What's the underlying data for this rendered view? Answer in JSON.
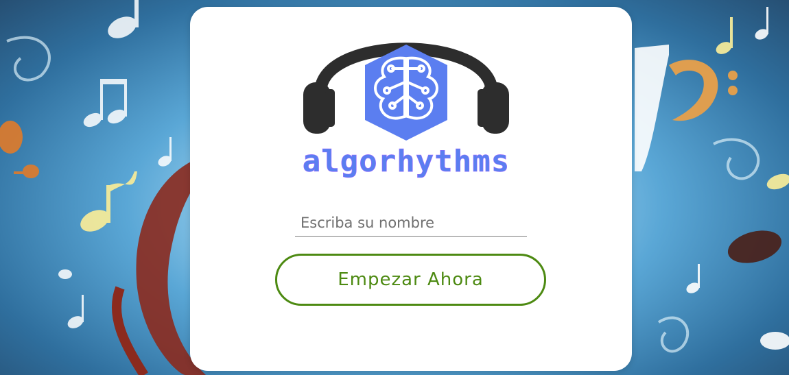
{
  "brand": {
    "wordmark": "algorhythms"
  },
  "form": {
    "name_placeholder": "Escriba su nombre",
    "name_value": "",
    "start_label": "Empezar Ahora"
  },
  "colors": {
    "accent_green": "#4d8a12",
    "logo_blue": "#5b7ef0",
    "headphones": "#2d2d2d",
    "card_background": "#ffffff"
  },
  "icons": {
    "logo": "brain-headphones-icon",
    "background": "music-notes-icon"
  }
}
